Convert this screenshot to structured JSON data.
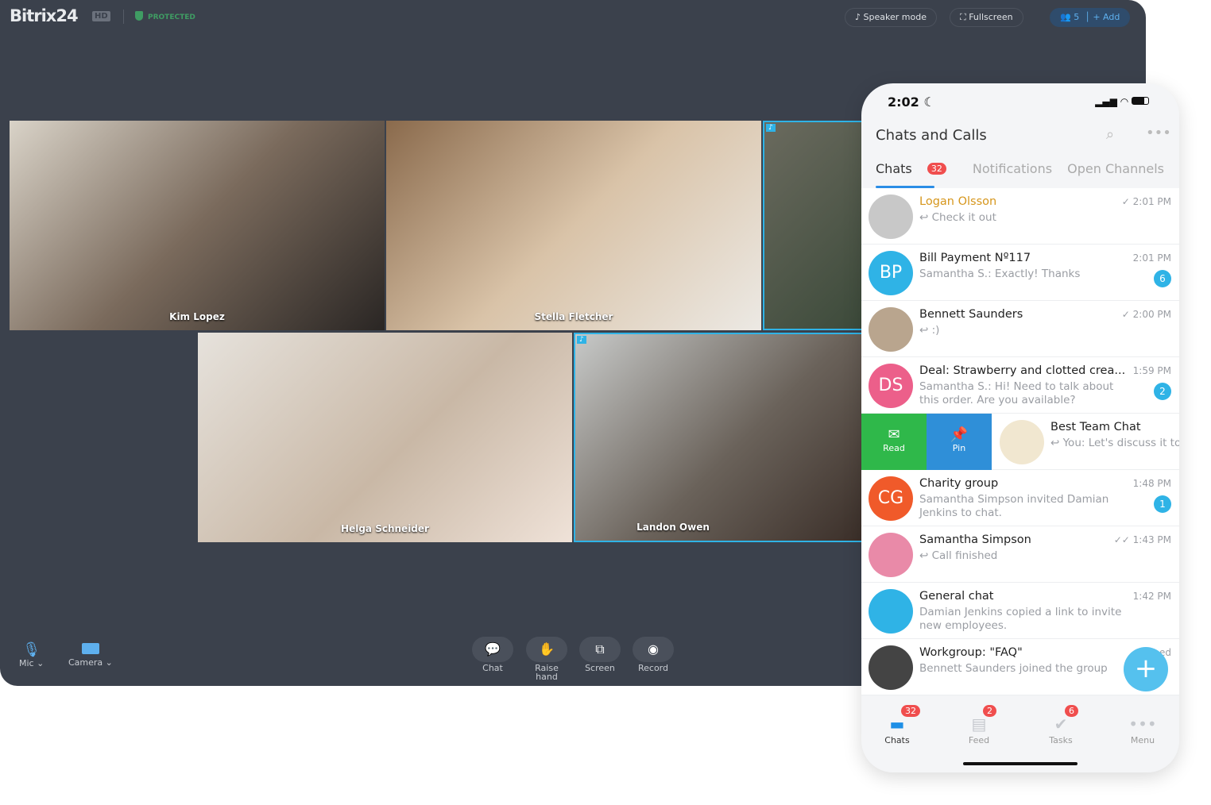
{
  "call": {
    "brand": "Bitrix24",
    "hd": "HD",
    "protected": "PROTECTED",
    "speaker_mode": "Speaker mode",
    "fullscreen": "Fullscreen",
    "participants": "5",
    "add": "+ Add",
    "participants_tiles": [
      {
        "name": "Kim Lopez"
      },
      {
        "name": "Stella Fletcher"
      },
      {
        "name": ""
      },
      {
        "name": "Helga Schneider"
      },
      {
        "name": "Landon Owen"
      }
    ],
    "mic": "Mic",
    "camera": "Camera",
    "controls": {
      "chat": "Chat",
      "raise_hand": "Raise hand",
      "screen": "Screen",
      "record": "Record"
    },
    "accent": "#2fb3e6"
  },
  "phone": {
    "time": "2:02",
    "title": "Chats and Calls",
    "tabs": {
      "chats": "Chats",
      "chats_badge": "32",
      "notifications": "Notifications",
      "open_channels": "Open Channels"
    },
    "chats": [
      {
        "name": "Logan Olsson",
        "msg": "↩ Check it out",
        "time": "✓ 2:01 PM",
        "color": "#c8c8c8"
      },
      {
        "name": "Bill Payment Nº117",
        "msg": "Samantha S.: Exactly! Thanks",
        "time": "2:01 PM",
        "count": "6",
        "initials": "BP",
        "color": "#2fb3e6"
      },
      {
        "name": "Bennett Saunders",
        "msg": "↩ :)",
        "time": "✓ 2:00 PM",
        "color": "#b9a58e"
      },
      {
        "name": "Deal:  Strawberry and clotted crea...",
        "msg": "Samantha S.: Hi! Need to talk about this order. Are you available?",
        "time": "1:59 PM",
        "count": "2",
        "initials": "DS",
        "color": "#ec5f8a"
      },
      {
        "name": "Best Team Chat",
        "msg": "↩ You: Let's discuss it tomorrow",
        "time": "",
        "color": "#f1e7d0"
      },
      {
        "name": "Charity group",
        "msg": "Samantha Simpson invited Damian Jenkins to chat.",
        "time": "1:48 PM",
        "count": "1",
        "initials": "CG",
        "color": "#f05a2a"
      },
      {
        "name": "Samantha Simpson",
        "msg": "↩ Call finished",
        "time": "✓✓ 1:43 PM",
        "color": "#e98aa8"
      },
      {
        "name": "General chat",
        "msg": "Damian Jenkins copied a link to invite new employees.",
        "time": "1:42 PM",
        "color": "#2fb3e6"
      },
      {
        "name": "Workgroup: \"FAQ\"",
        "msg": "Bennett Saunders joined the group",
        "time": "ed",
        "color": "#444"
      }
    ],
    "swipe": {
      "read": "Read",
      "pin": "Pin"
    },
    "nav": {
      "chats": "Chats",
      "chats_badge": "32",
      "feed": "Feed",
      "feed_badge": "2",
      "tasks": "Tasks",
      "tasks_badge": "6",
      "menu": "Menu"
    }
  }
}
